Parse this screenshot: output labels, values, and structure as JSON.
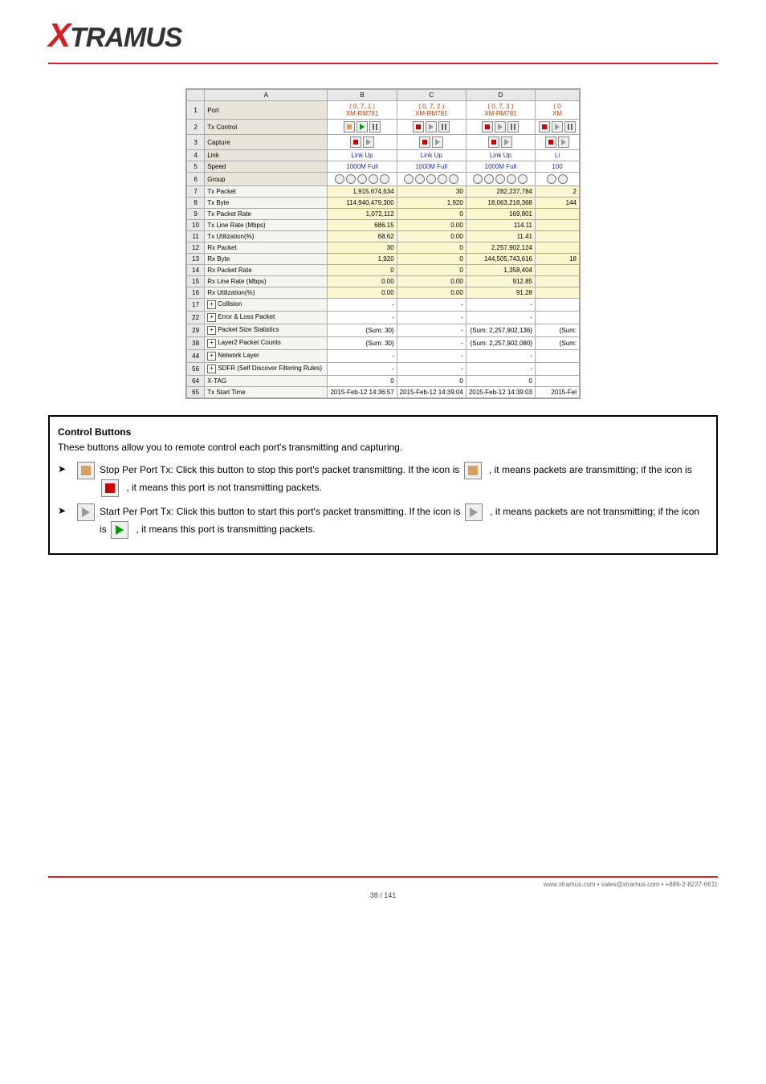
{
  "logo": {
    "first": "X",
    "rest": "TRAMUS"
  },
  "cols": [
    "",
    "A",
    "B",
    "C",
    "D",
    ""
  ],
  "ports": [
    {
      "top": "( 0, 7, 1 )",
      "bot": "XM-RM781"
    },
    {
      "top": "( 0, 7, 2 )",
      "bot": "XM-RM781"
    },
    {
      "top": "( 0, 7, 3 )",
      "bot": "XM-RM781"
    },
    {
      "top": "( 0",
      "bot": "XM"
    }
  ],
  "rows": [
    {
      "n": "1",
      "label": "Port",
      "type": "port"
    },
    {
      "n": "2",
      "label": "Tx Control",
      "type": "ctrl3"
    },
    {
      "n": "3",
      "label": "Capture",
      "type": "ctrl2"
    },
    {
      "n": "4",
      "label": "Link",
      "type": "link",
      "v": [
        "Link Up",
        "Link Up",
        "Link Up",
        "Li"
      ]
    },
    {
      "n": "5",
      "label": "Speed",
      "type": "link",
      "v": [
        "1000M Full",
        "1000M Full",
        "1000M Full",
        "100"
      ]
    },
    {
      "n": "6",
      "label": "Group",
      "type": "grp"
    },
    {
      "n": "7",
      "label": "Tx Packet",
      "type": "y",
      "v": [
        "1,915,674,634",
        "30",
        "282,237,784",
        "2"
      ]
    },
    {
      "n": "8",
      "label": "Tx Byte",
      "type": "y",
      "v": [
        "114,940,479,300",
        "1,920",
        "18,063,218,368",
        "144"
      ]
    },
    {
      "n": "9",
      "label": "Tx Packet Rate",
      "type": "y",
      "v": [
        "1,072,112",
        "0",
        "169,801",
        ""
      ]
    },
    {
      "n": "10",
      "label": "Tx Line Rate (Mbps)",
      "type": "y",
      "v": [
        "686.15",
        "0.00",
        "114.11",
        ""
      ]
    },
    {
      "n": "11",
      "label": "Tx Utilization(%)",
      "type": "y",
      "v": [
        "68.62",
        "0.00",
        "11.41",
        ""
      ]
    },
    {
      "n": "12",
      "label": "Rx Packet",
      "type": "y",
      "v": [
        "30",
        "0",
        "2,257,902,124",
        ""
      ]
    },
    {
      "n": "13",
      "label": "Rx Byte",
      "type": "y",
      "v": [
        "1,920",
        "0",
        "144,505,743,616",
        "18"
      ]
    },
    {
      "n": "14",
      "label": "Rx Packet Rate",
      "type": "y",
      "v": [
        "0",
        "0",
        "1,358,404",
        ""
      ]
    },
    {
      "n": "15",
      "label": "Rx Line Rate (Mbps)",
      "type": "y",
      "v": [
        "0.00",
        "0.00",
        "912.85",
        ""
      ]
    },
    {
      "n": "16",
      "label": "Rx Utilization(%)",
      "type": "y",
      "v": [
        "0.00",
        "0.00",
        "91.28",
        ""
      ]
    },
    {
      "n": "17",
      "label": "Collision",
      "type": "exp",
      "v": [
        "-",
        "-",
        "-",
        ""
      ]
    },
    {
      "n": "22",
      "label": "Error & Loss Packet",
      "type": "exp",
      "v": [
        "-",
        "-",
        "-",
        ""
      ]
    },
    {
      "n": "29",
      "label": "Packet Size Statistics",
      "type": "exp",
      "v": [
        "{Sum: 30}",
        "-",
        "{Sum: 2,257,902,136}",
        "{Sum:"
      ]
    },
    {
      "n": "38",
      "label": "Layer2 Packet Counts",
      "type": "exp",
      "v": [
        "{Sum: 30}",
        "-",
        "{Sum: 2,257,902,080}",
        "{Sum:"
      ]
    },
    {
      "n": "44",
      "label": "Network Layer",
      "type": "exp",
      "v": [
        "-",
        "-",
        "-",
        ""
      ]
    },
    {
      "n": "56",
      "label": "SDFR (Self Discover Filtering Rules)",
      "type": "exp",
      "v": [
        "-",
        "-",
        "-",
        ""
      ]
    },
    {
      "n": "64",
      "label": "X-TAG",
      "type": "plain",
      "v": [
        "0",
        "0",
        "0",
        ""
      ]
    },
    {
      "n": "65",
      "label": "Tx Start Time",
      "type": "plain",
      "v": [
        "2015-Feb-12 14:36:57",
        "2015-Feb-12 14:39:04",
        "2015-Feb-12 14:39:03",
        "2015-Fel"
      ]
    }
  ],
  "desc": {
    "title": "Control Buttons",
    "sub": "These buttons allow you to remote control each port's transmitting and capturing.",
    "b1": "Stop Per Port Tx: Click this button to stop this port's packet transmitting. If the icon is",
    "b1b": ", it means packets are transmitting; if the icon is",
    "b1c": ", it means this port is not transmitting packets.",
    "b2": "Start Per Port Tx: Click this button to start this port's packet transmitting. If the icon is",
    "b2b": ", it means packets are not transmitting; if the icon is",
    "b2c": ", it means this port is transmitting packets."
  },
  "footer": {
    "line1": "www.xtramus.com  •  sales@xtramus.com  •  +886-2-8227-6611",
    "line2": "38 / 141"
  }
}
